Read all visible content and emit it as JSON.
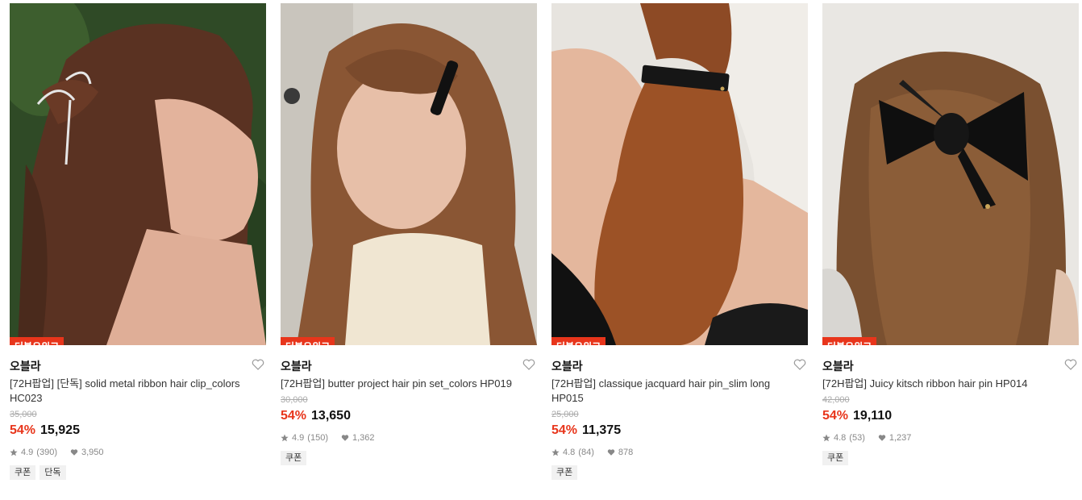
{
  "products": [
    {
      "badge": "더블유위크",
      "brand": "오블라",
      "title": "[72H팝업] [단독] solid metal ribbon hair clip_colors HC023",
      "original_price": "35,000",
      "discount": "54%",
      "price": "15,925",
      "rating": "4.9",
      "reviews": "(390)",
      "likes": "3,950",
      "tags": [
        "쿠폰",
        "단독"
      ],
      "photo": "woman-with-silver-ribbon-hair-clip"
    },
    {
      "badge": "더블유위크",
      "brand": "오블라",
      "title": "[72H팝업] butter project hair pin set_colors HP019",
      "original_price": "30,000",
      "discount": "54%",
      "price": "13,650",
      "rating": "4.9",
      "reviews": "(150)",
      "likes": "1,362",
      "tags": [
        "쿠폰"
      ],
      "photo": "woman-with-black-hair-pin"
    },
    {
      "badge": "더블유위크",
      "brand": "오블라",
      "title": "[72H팝업] classique jacquard hair pin_slim long HP015",
      "original_price": "25,000",
      "discount": "54%",
      "price": "11,375",
      "rating": "4.8",
      "reviews": "(84)",
      "likes": "878",
      "tags": [
        "쿠폰"
      ],
      "photo": "ponytail-with-black-jacquard-pin"
    },
    {
      "badge": "더블유위크",
      "brand": "오블라",
      "title": "[72H팝업] Juicy kitsch ribbon hair pin HP014",
      "original_price": "42,000",
      "discount": "54%",
      "price": "19,110",
      "rating": "4.8",
      "reviews": "(53)",
      "likes": "1,237",
      "tags": [
        "쿠폰"
      ],
      "photo": "hair-with-black-ribbon-bow"
    }
  ],
  "colors": {
    "accent": "#e8351b",
    "text": "#111111",
    "muted": "#888888",
    "tag_bg": "#f1f1f1"
  }
}
